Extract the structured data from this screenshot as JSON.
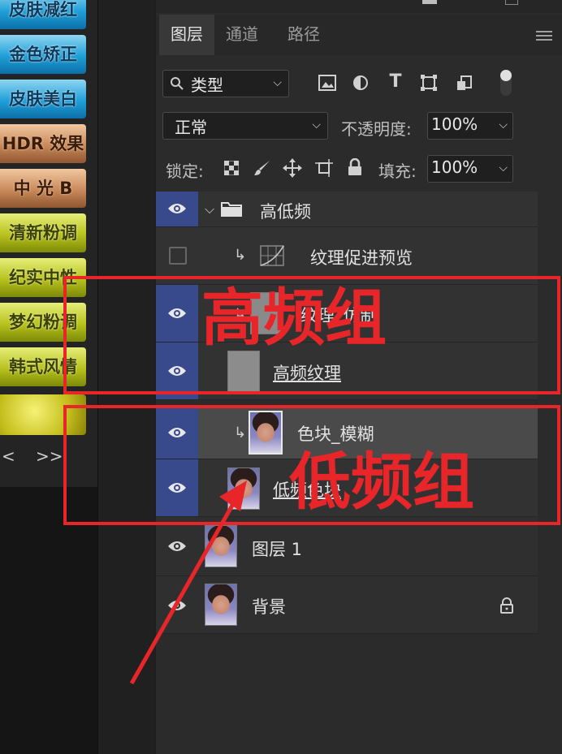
{
  "presets": [
    {
      "label": "皮肤减红",
      "style": "blue"
    },
    {
      "label": "金色矫正",
      "style": "blue"
    },
    {
      "label": "皮肤美白",
      "style": "blue"
    },
    {
      "label": "HDR 效果",
      "style": "copper"
    },
    {
      "label": "中 光 B",
      "style": "copper"
    },
    {
      "label": "清新粉调",
      "style": "lime"
    },
    {
      "label": "纪实中性",
      "style": "lime"
    },
    {
      "label": "梦幻粉调",
      "style": "lime"
    },
    {
      "label": "韩式风情",
      "style": "lime"
    }
  ],
  "pager": {
    "prev": "<",
    "next": ">>"
  },
  "tabs": [
    "图层",
    "通道",
    "路径"
  ],
  "filter": {
    "kind": "类型"
  },
  "blend": {
    "mode": "正常",
    "opacity_label": "不透明度:",
    "opacity": "100%"
  },
  "lock": {
    "label": "锁定:",
    "fill_label": "填充:",
    "fill": "100%"
  },
  "layers": [
    {
      "name": "高低频",
      "type": "group",
      "visible": true
    },
    {
      "name": "纹理促进预览",
      "type": "curves",
      "visible": false
    },
    {
      "name": "纹理_仿制",
      "type": "gray",
      "visible": true
    },
    {
      "name": "高频纹理",
      "type": "gray",
      "visible": true
    },
    {
      "name": "色块_模糊",
      "type": "photo",
      "visible": true
    },
    {
      "name": "低频色块",
      "type": "photo",
      "visible": true
    },
    {
      "name": "图层 1",
      "type": "photo",
      "visible": true
    },
    {
      "name": "背景",
      "type": "photo",
      "visible": true
    }
  ],
  "annotations": {
    "high_group": "高频组",
    "low_group": "低频组",
    "accent": "#e8262a"
  }
}
